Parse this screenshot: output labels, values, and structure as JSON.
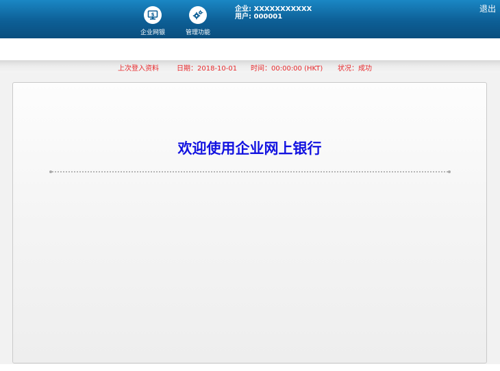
{
  "header": {
    "nav": [
      {
        "label": "企业网银",
        "icon": "monitor-dollar-icon"
      },
      {
        "label": "管理功能",
        "icon": "gears-icon"
      }
    ],
    "company_label": "企业: XXXXXXXXXXX",
    "user_label": "用户: 000001",
    "logout_label": "退出"
  },
  "login_info": {
    "title": "上次登入资料",
    "date": "日期：2018-10-01",
    "time": "时间：00:00:00 (HKT)",
    "status": "状况：成功"
  },
  "main": {
    "welcome": "欢迎使用企业网上银行"
  },
  "colors": {
    "header_top": "#1a87c4",
    "header_bottom": "#0a4e7e",
    "login_info_text": "#e8292c",
    "welcome_text": "#1212e0"
  }
}
